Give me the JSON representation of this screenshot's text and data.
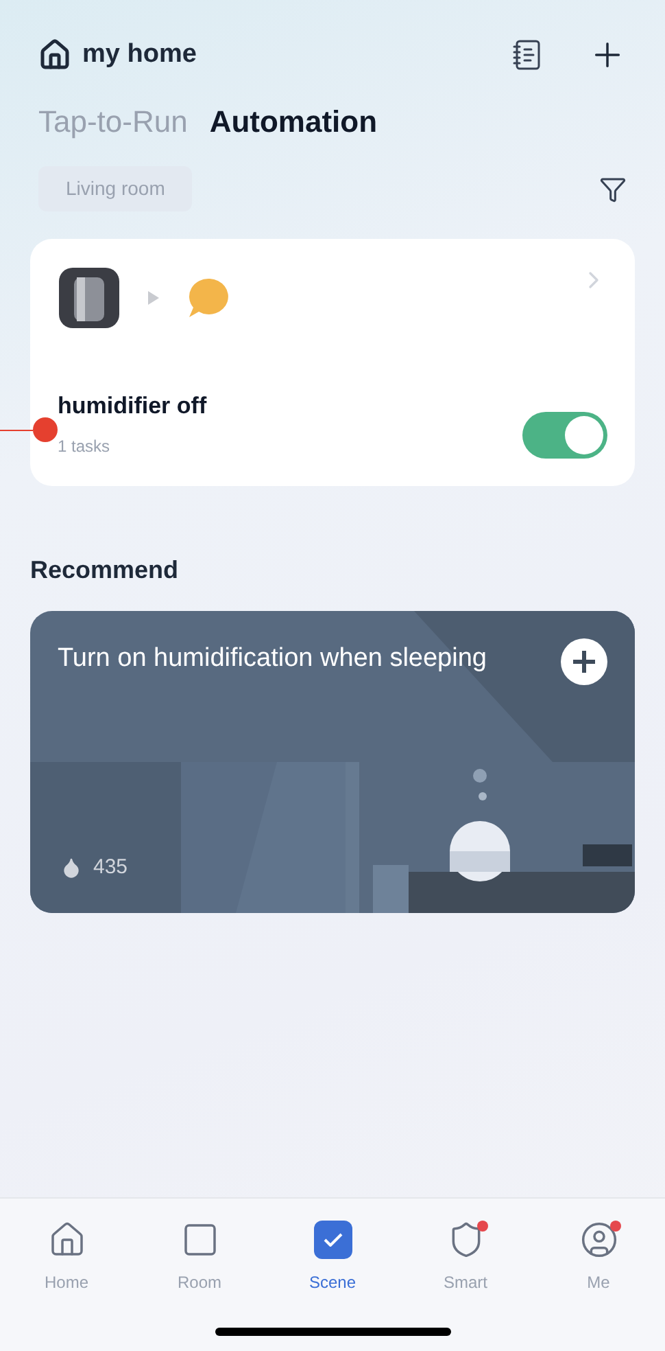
{
  "header": {
    "home_name": "my home"
  },
  "tabs": [
    {
      "label": "Tap-to-Run",
      "selected": false
    },
    {
      "label": "Automation",
      "selected": true
    }
  ],
  "room_filter": {
    "label": "Living room"
  },
  "automations": [
    {
      "name": "humidifier off",
      "tasks": "1 tasks",
      "on": true
    }
  ],
  "recommend": {
    "title": "Recommend",
    "cards": [
      {
        "title": "Turn on humidification when sleeping",
        "count": "435"
      }
    ]
  },
  "nav": [
    {
      "label": "Home",
      "kind": "home",
      "selected": false,
      "badge": false
    },
    {
      "label": "Room",
      "kind": "room",
      "selected": false,
      "badge": false
    },
    {
      "label": "Scene",
      "kind": "scene",
      "selected": true,
      "badge": false
    },
    {
      "label": "Smart",
      "kind": "smart",
      "selected": false,
      "badge": true
    },
    {
      "label": "Me",
      "kind": "me",
      "selected": false,
      "badge": true
    }
  ]
}
